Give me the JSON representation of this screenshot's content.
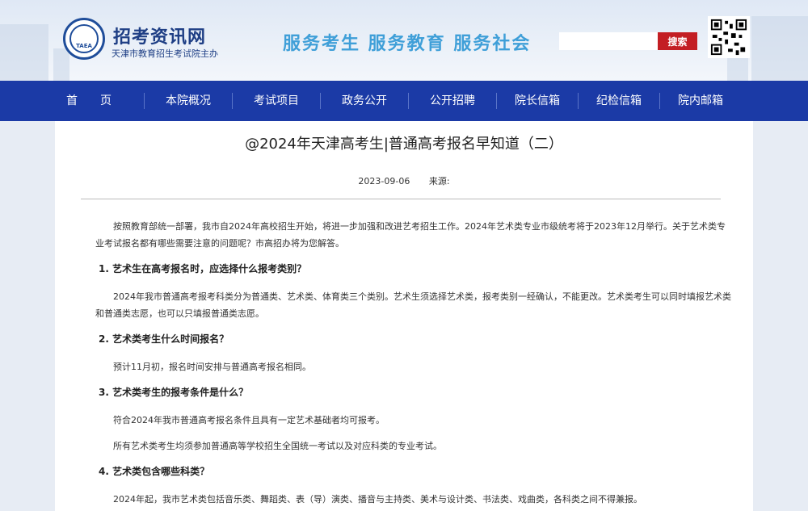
{
  "header": {
    "site_name": "招考资讯网",
    "site_sub": "天津市教育招生考试院主办",
    "logo_text": "TAEA",
    "slogan": "服务考生  服务教育  服务社会",
    "search_placeholder": "",
    "search_label": "搜索"
  },
  "nav": {
    "items": [
      "首　　页",
      "本院概况",
      "考试项目",
      "政务公开",
      "公开招聘",
      "院长信箱",
      "纪检信箱",
      "院内邮箱"
    ]
  },
  "article": {
    "title": "@2024年天津高考生|普通高考报名早知道（二）",
    "date": "2023-09-06",
    "source_label": "来源:",
    "paragraphs": [
      {
        "type": "p",
        "text": "按照教育部统一部署，我市自2024年高校招生开始，将进一步加强和改进艺考招生工作。2024年艺术类专业市级统考将于2023年12月举行。关于艺术类专业考试报名都有哪些需要注意的问题呢？市高招办将为您解答。"
      },
      {
        "type": "h",
        "text": "1. 艺术生在高考报名时，应选择什么报考类别？"
      },
      {
        "type": "p",
        "text": "2024年我市普通高考报考科类分为普通类、艺术类、体育类三个类别。艺术生须选择艺术类，报考类别一经确认，不能更改。艺术类考生可以同时填报艺术类和普通类志愿，也可以只填报普通类志愿。"
      },
      {
        "type": "h",
        "text": "2. 艺术类考生什么时间报名？"
      },
      {
        "type": "p",
        "text": "预计11月初，报名时间安排与普通高考报名相同。"
      },
      {
        "type": "h",
        "text": "3. 艺术类考生的报考条件是什么？"
      },
      {
        "type": "p",
        "text": "符合2024年我市普通高考报名条件且具有一定艺术基础者均可报考。"
      },
      {
        "type": "p",
        "text": "所有艺术类考生均须参加普通高等学校招生全国统一考试以及对应科类的专业考试。"
      },
      {
        "type": "h",
        "text": "4. 艺术类包含哪些科类？"
      },
      {
        "type": "p",
        "text": "2024年起，我市艺术类包括音乐类、舞蹈类、表（导）演类、播音与主持类、美术与设计类、书法类、戏曲类，各科类之间不得兼报。"
      }
    ]
  },
  "colors": {
    "nav_bg": "#1b3aa6",
    "brand": "#1f3f85",
    "slogan": "#3f9fd8",
    "search_button": "#c31e23"
  }
}
